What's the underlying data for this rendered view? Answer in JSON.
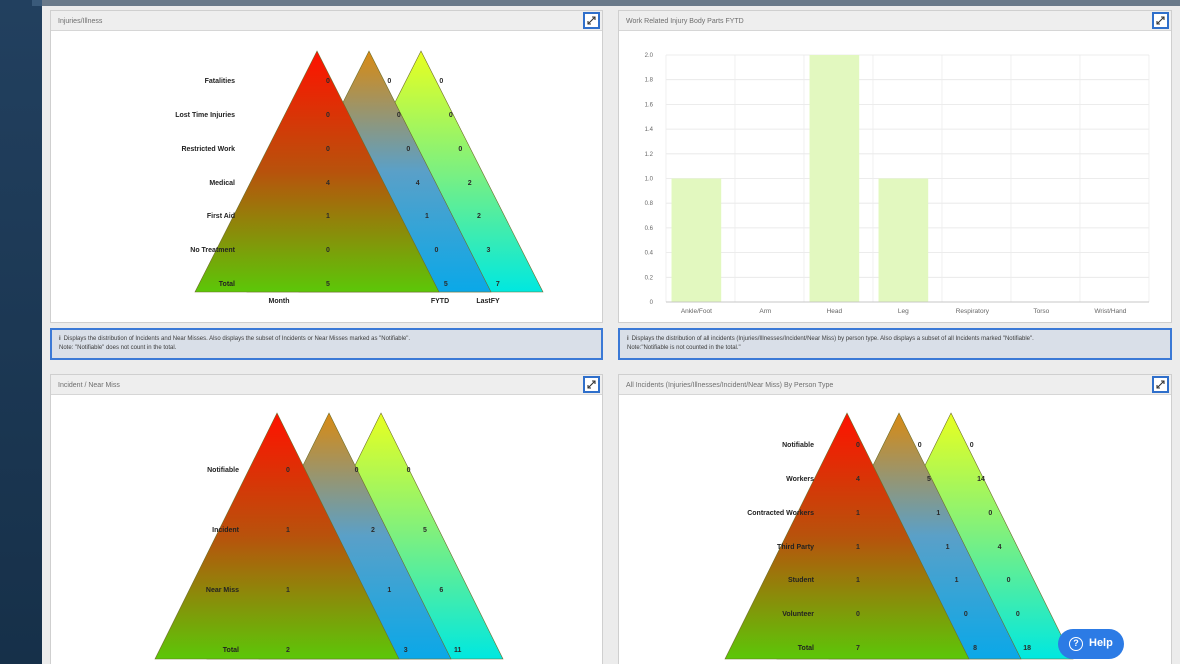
{
  "panels": [
    {
      "id": "p1",
      "title": "Injuries/Illness",
      "labels": [
        "Fatalities",
        "Lost Time Injuries",
        "Restricted Work",
        "Medical",
        "First Aid",
        "No Treatment",
        "Total"
      ],
      "values": [
        [
          "0",
          "0",
          "0"
        ],
        [
          "0",
          "0",
          "0"
        ],
        [
          "0",
          "0",
          "0"
        ],
        [
          "4",
          "4",
          "2"
        ],
        [
          "1",
          "1",
          "2"
        ],
        [
          "0",
          "0",
          "3"
        ],
        [
          "5",
          "5",
          "7"
        ]
      ],
      "columns": [
        "Month",
        "FYTD",
        "LastFY"
      ]
    },
    {
      "id": "p3",
      "title": "Incident / Near Miss",
      "labels": [
        "Notifiable",
        "Incident",
        "Near Miss",
        "Total"
      ],
      "values": [
        [
          "0",
          "0",
          "0"
        ],
        [
          "1",
          "2",
          "5"
        ],
        [
          "1",
          "1",
          "6"
        ],
        [
          "2",
          "3",
          "11"
        ]
      ],
      "columns": [
        "",
        "",
        ""
      ]
    },
    {
      "id": "p4",
      "title": "All Incidents (Injuries/Illnesses/Incident/Near Miss) By Person Type",
      "labels": [
        "Notifiable",
        "Workers",
        "Contracted Workers",
        "Third Party",
        "Student",
        "Volunteer",
        "Total"
      ],
      "values": [
        [
          "0",
          "0",
          "0"
        ],
        [
          "4",
          "5",
          "14"
        ],
        [
          "1",
          "1",
          "0"
        ],
        [
          "1",
          "1",
          "4"
        ],
        [
          "1",
          "1",
          "0"
        ],
        [
          "0",
          "0",
          "0"
        ],
        [
          "7",
          "8",
          "18"
        ]
      ],
      "columns": [
        "",
        "",
        ""
      ]
    }
  ],
  "bar_panel_title": "Work Related Injury Body Parts FYTD",
  "chart_data": {
    "type": "bar",
    "title": "Work Related Injury Body Parts FYTD",
    "categories": [
      "Ankle/Foot",
      "Arm",
      "Head",
      "Leg",
      "Respiratory",
      "Torso",
      "Wrist/Hand"
    ],
    "values": [
      1,
      0,
      2,
      1,
      0,
      0,
      0
    ],
    "ylim": [
      0,
      2
    ],
    "yticks": [
      "0",
      "0.2",
      "0.4",
      "0.6",
      "0.8",
      "1.0",
      "1.2",
      "1.4",
      "1.6",
      "1.8",
      "2.0"
    ],
    "bar_color": "#e2f8bf",
    "grid": true
  },
  "info_left": {
    "icon": "i",
    "line1": "Displays the distribution of Incidents and Near Misses. Also displays the subset of Incidents or Near Misses marked as \"Notifiable\".",
    "line2": "Note: \"Notifiable\" does not count in the total."
  },
  "info_right": {
    "icon": "i",
    "line1": "Displays the distribution of all incidents (Injuries/Illnesses/Incident/Near Miss) by person type. Also displays a subset of all Incidents marked \"Notifiable\".",
    "line2": "Note:\"Notifiable is not counted in the total.\""
  },
  "help": {
    "label": "Help",
    "icon": "?"
  }
}
